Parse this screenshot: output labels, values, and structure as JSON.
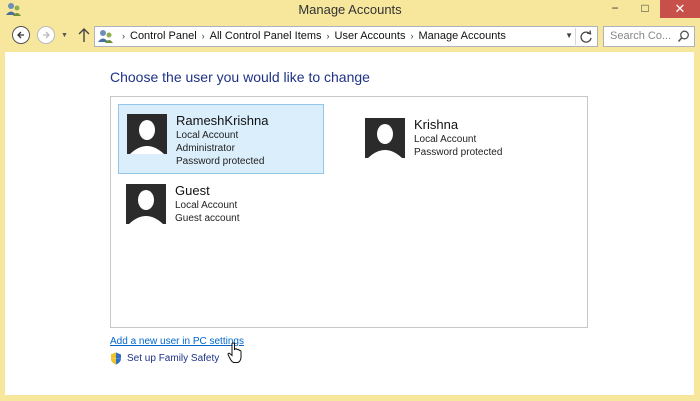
{
  "window": {
    "title": "Manage Accounts",
    "minimize": "−",
    "maximize": "□",
    "close": "✕"
  },
  "navbar": {
    "breadcrumbs": [
      "Control Panel",
      "All Control Panel Items",
      "User Accounts",
      "Manage Accounts"
    ],
    "search_placeholder": "Search Co..."
  },
  "main": {
    "heading": "Choose the user you would like to change",
    "accounts": [
      {
        "name": "RameshKrishna",
        "lines": [
          "Local Account",
          "Administrator",
          "Password protected"
        ],
        "selected": true
      },
      {
        "name": "Krishna",
        "lines": [
          "Local Account",
          "Password protected"
        ],
        "selected": false
      },
      {
        "name": "Guest",
        "lines": [
          "Local Account",
          "Guest account"
        ],
        "selected": false
      }
    ],
    "add_user_link": "Add a new user in PC settings",
    "family_safety_link": "Set up Family Safety"
  },
  "colors": {
    "frame": "#f6e79d",
    "heading": "#1e3287",
    "link": "#0066cc",
    "selection": "#daeefb",
    "close_button": "#c7504b"
  }
}
